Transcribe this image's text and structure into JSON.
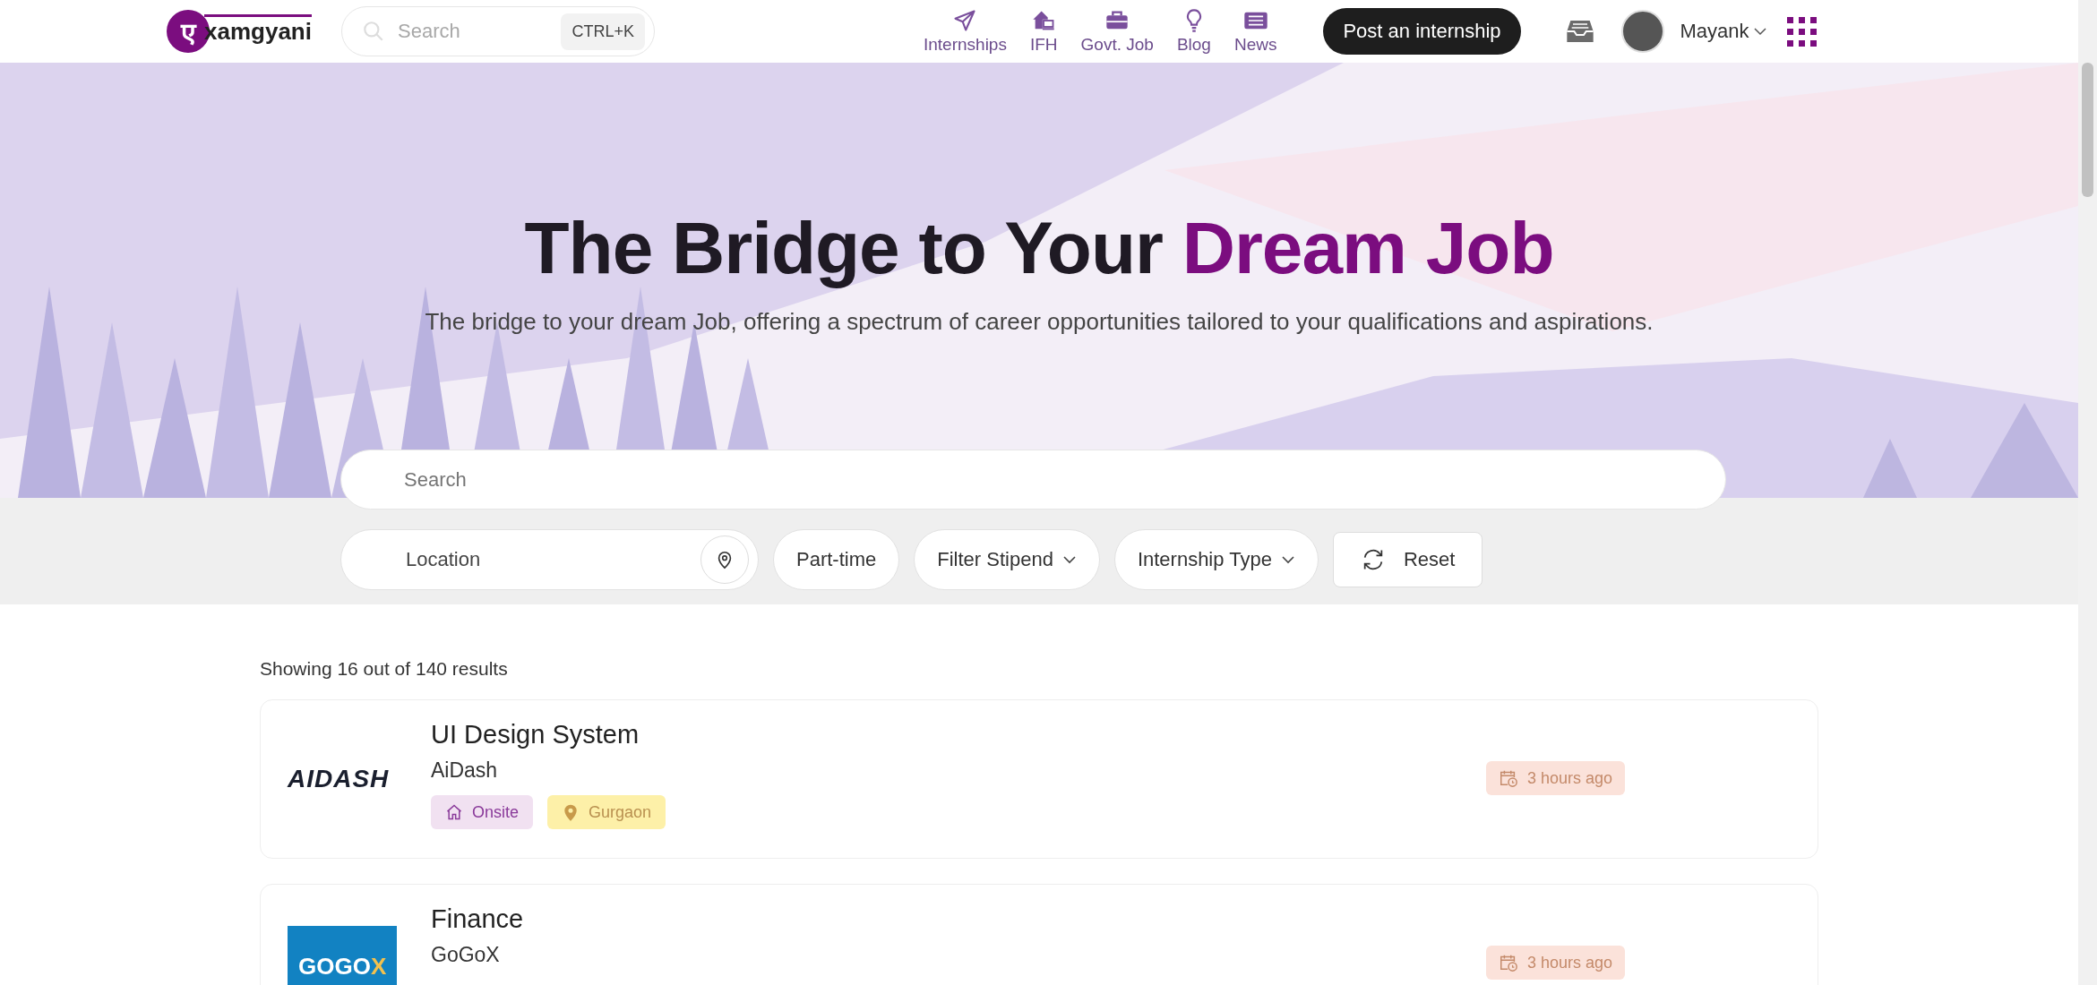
{
  "header": {
    "logo": {
      "mark": "ए",
      "text": "xamgyani"
    },
    "search": {
      "placeholder": "Search",
      "shortcut": "CTRL+K"
    },
    "nav": [
      {
        "label": "Internships",
        "kind": "plane"
      },
      {
        "label": "IFH",
        "kind": "home"
      },
      {
        "label": "Govt. Job",
        "kind": "briefcase"
      },
      {
        "label": "Blog",
        "kind": "bulb"
      },
      {
        "label": "News",
        "kind": "news"
      }
    ],
    "post_button": "Post an internship",
    "user": {
      "name": "Mayank"
    }
  },
  "hero": {
    "title": "The Bridge to Your ",
    "title_accent": "Dream Job",
    "subtitle": "The bridge to your dream Job, offering a spectrum of career opportunities tailored to your qualifications and aspirations.",
    "search": {
      "placeholder": "Search"
    }
  },
  "filters": {
    "location": {
      "placeholder": "Location"
    },
    "chips": [
      {
        "label": "Part-time",
        "dropdown": false
      },
      {
        "label": "Filter Stipend",
        "dropdown": true
      },
      {
        "label": "Internship Type",
        "dropdown": true
      }
    ],
    "reset": "Reset"
  },
  "results": {
    "summary": "Showing 16 out of 140 results",
    "items": [
      {
        "title": "UI Design System",
        "company": "AiDash",
        "logo": {
          "kind": "dash",
          "text": "AIDASH"
        },
        "tags": [
          {
            "label": "Onsite",
            "kind": "mode"
          },
          {
            "label": "Gurgaon",
            "kind": "location"
          }
        ],
        "posted": "3 hours ago"
      },
      {
        "title": "Finance",
        "company": "GoGoX",
        "logo": {
          "kind": "block",
          "text": "GOGO",
          "accent": "X"
        },
        "posted": "3 hours ago"
      }
    ]
  }
}
